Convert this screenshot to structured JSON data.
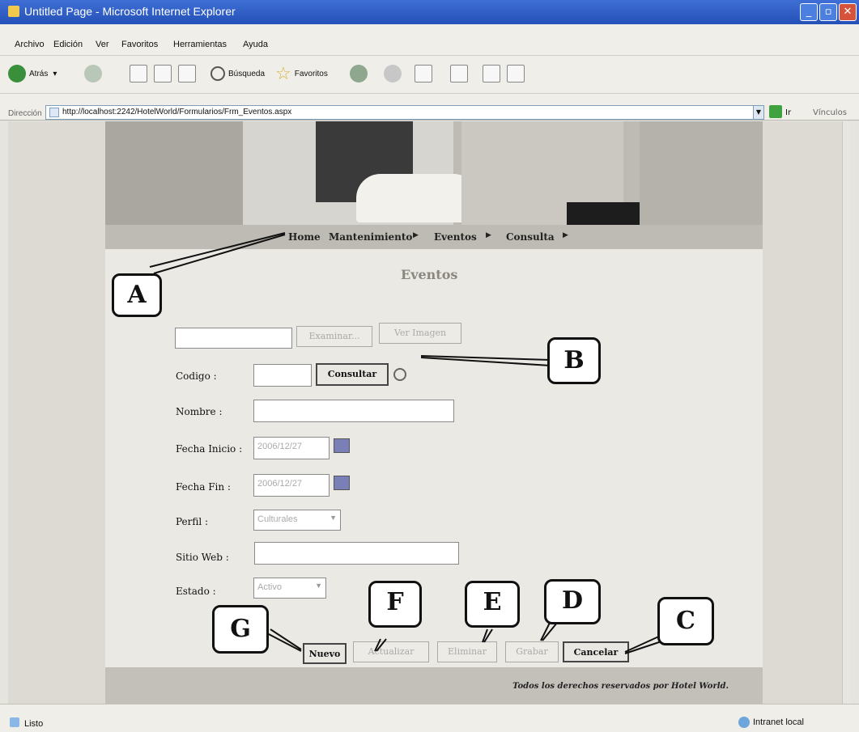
{
  "window": {
    "title": "Untitled Page - Microsoft Internet Explorer"
  },
  "menu": [
    "Archivo",
    "Edición",
    "Ver",
    "Favoritos",
    "Herramientas",
    "Ayuda"
  ],
  "toolbar": {
    "back": "Atrás",
    "search": "Búsqueda",
    "favorites": "Favoritos"
  },
  "address": {
    "label": "Dirección",
    "url": "http://localhost:2242/HotelWorld/Formularios/Frm_Eventos.aspx",
    "go": "Ir",
    "links": "Vínculos"
  },
  "nav": {
    "home": "Home",
    "mantenimiento": "Mantenimiento",
    "eventos": "Eventos",
    "consulta": "Consulta"
  },
  "form": {
    "title": "Eventos",
    "examinar": "Examinar...",
    "ver_imagen": "Ver Imagen",
    "codigo_label": "Codigo :",
    "consultar": "Consultar",
    "nombre_label": "Nombre :",
    "fecha_inicio_label": "Fecha Inicio :",
    "fecha_inicio_value": "2006/12/27",
    "fecha_fin_label": "Fecha Fin :",
    "fecha_fin_value": "2006/12/27",
    "perfil_label": "Perfil :",
    "perfil_value": "Culturales",
    "sitio_web_label": "Sitio Web :",
    "estado_label": "Estado :",
    "estado_value": "Activo"
  },
  "buttons": {
    "nuevo": "Nuevo",
    "actualizar": "Actualizar",
    "eliminar": "Eliminar",
    "grabar": "Grabar",
    "cancelar": "Cancelar"
  },
  "footer": "Todos los derechos reservados por Hotel World.",
  "callouts": {
    "a": "A",
    "b": "B",
    "c": "C",
    "d": "D",
    "e": "E",
    "f": "F",
    "g": "G"
  },
  "status": {
    "left": "Listo",
    "right": "Intranet local"
  }
}
